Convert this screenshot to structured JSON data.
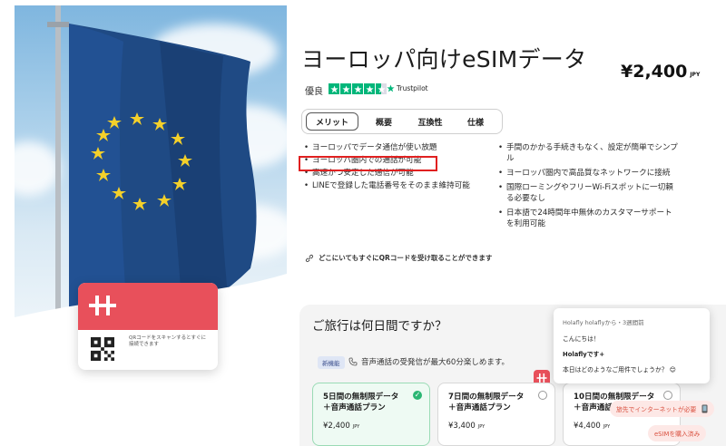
{
  "product": {
    "title": "ヨーロッパ向けeSIMデータ",
    "price": "¥2,400",
    "currency": "JPY",
    "rating_label": "優良",
    "rating_stars": 4.5,
    "trustpilot": "Trustpilot"
  },
  "card": {
    "caption": "QRコードをスキャンするとすぐに接続できます"
  },
  "tabs": [
    {
      "label": "メリット",
      "active": true
    },
    {
      "label": "概要"
    },
    {
      "label": "互換性"
    },
    {
      "label": "仕様"
    }
  ],
  "features_left": [
    "ヨーロッパでデータ通信が使い放題",
    "ヨーロッパ圏内での通話が可能",
    "高速かつ安定した通信が可能",
    "LINEで登録した電話番号をそのまま維持可能"
  ],
  "features_right": [
    "手間のかかる手続きもなく、設定が簡単でシンプル",
    "ヨーロッパ圏内で高品質なネットワークに接続",
    "国際ローミングやフリーWi-Fiスポットに一切頼る必要なし",
    "日本語で24時間年中無休のカスタマーサポートを利用可能"
  ],
  "qr_note": "どこにいてもすぐにQRコードを受け取ることができます",
  "trip": {
    "title": "ご旅行は何日間ですか？",
    "badge": "新機能",
    "phone_note": "音声通話の受発信が最大60分楽しめます。"
  },
  "plans": [
    {
      "name_line1": "5日間の無制限データ",
      "name_line2": "＋音声通話プラン",
      "price": "¥2,400",
      "currency": "JPY",
      "selected": true
    },
    {
      "name_line1": "7日間の無制限データ",
      "name_line2": "＋音声通話プラン",
      "price": "¥3,400",
      "currency": "JPY",
      "selected": false
    },
    {
      "name_line1": "10日間の無制限データ",
      "name_line2": "＋音声通話プラン",
      "price": "¥4,400",
      "currency": "JPY",
      "selected": false
    }
  ],
  "chat": {
    "from": "Holafly holaflyから・3週間前",
    "line1": "こんにちは！",
    "line2": "Holaflyです+",
    "line3": "本日はどのようなご用件でしょうか？ 😊"
  },
  "chips": {
    "chip1": "旅先でインターネットが必要",
    "chip2": "eSIMを購入済み"
  },
  "colors": {
    "brand_red": "#e8505b",
    "trustpilot_green": "#00b67a",
    "selected_green": "#2bb673",
    "highlight_red": "#e02020"
  }
}
